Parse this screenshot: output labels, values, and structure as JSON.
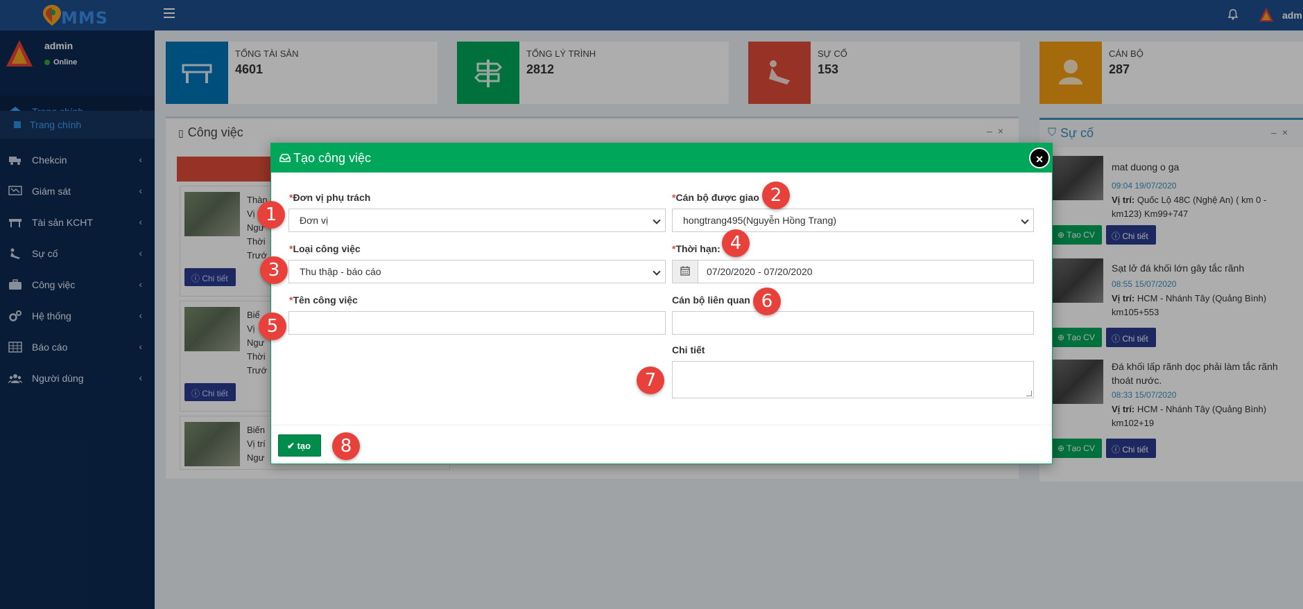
{
  "topbar": {
    "brand": "MMS",
    "user": "adm"
  },
  "sidebar": {
    "user": {
      "name": "admin",
      "status": "Online"
    },
    "items": [
      {
        "label": "Trang chính",
        "icon": "home-icon"
      },
      {
        "label": "Chekcin",
        "icon": "truck-icon"
      },
      {
        "label": "Giám sát",
        "icon": "monitor-icon"
      },
      {
        "label": "Tài sản KCHT",
        "icon": "barrier-icon"
      },
      {
        "label": "Sự cố",
        "icon": "digging-icon"
      },
      {
        "label": "Công việc",
        "icon": "briefcase-icon"
      },
      {
        "label": "Hệ thống",
        "icon": "gears-icon"
      },
      {
        "label": "Báo cáo",
        "icon": "table-icon"
      },
      {
        "label": "Người dùng",
        "icon": "users-icon"
      }
    ],
    "sub_item": "Trang chính"
  },
  "stats": [
    {
      "label": "TỔNG TÀI SẢN",
      "value": "4601",
      "color": "#0073b7"
    },
    {
      "label": "TỔNG LÝ TRÌNH",
      "value": "2812",
      "color": "#00a65a"
    },
    {
      "label": "SỰ CỐ",
      "value": "153",
      "color": "#dd4b39"
    },
    {
      "label": "CÁN BỘ",
      "value": "287",
      "color": "#f39c12"
    }
  ],
  "work_panel": {
    "title": "Công việc",
    "cards": [
      {
        "lines": [
          "Thàn",
          "Vị",
          "Ngư",
          "Thời",
          "Trướ"
        ],
        "button": "Chi tiết"
      },
      {
        "lines": [
          "Biể",
          "Vị",
          "Ngư",
          "Thời",
          "Trướ"
        ],
        "button": "Chi tiết"
      },
      {
        "lines": [
          "Biến",
          "Vị trí",
          "Ngư"
        ],
        "button": ""
      }
    ]
  },
  "incident_panel": {
    "title": "Sự cố",
    "items": [
      {
        "title": "mat duong o ga",
        "time": "09:04 19/07/2020",
        "loc_label": "Vị trí:",
        "loc": "Quốc Lộ 48C (Nghệ An) ( km 0 - km123) Km99+747"
      },
      {
        "title": "Sạt lở đá khối lớn gây tắc rãnh",
        "time": "08:55 15/07/2020",
        "loc_label": "Vị trí:",
        "loc": "HCM - Nhánh Tây (Quảng Bình) km105+553"
      },
      {
        "title": "Đá khối lấp rãnh dọc phải làm tắc rãnh thoát nước.",
        "time": "08:33 15/07/2020",
        "loc_label": "Vị trí:",
        "loc": "HCM - Nhánh Tây (Quảng Bình) km102+19"
      }
    ],
    "btn_tao_cv": "Tạo CV",
    "btn_chi_tiet": "Chi tiết"
  },
  "modal": {
    "title": "Tạo công việc",
    "close": "×",
    "fields": {
      "don_vi": {
        "label": "Đơn vị phụ trách",
        "value": "Đơn vị"
      },
      "can_bo": {
        "label": "Cán bộ được giao",
        "value": "hongtrang495(Nguyễn Hồng Trang)"
      },
      "loai": {
        "label": "Loại công việc",
        "value": "Thu thập - báo cáo"
      },
      "thoi_han": {
        "label": "Thời hạn:",
        "value": "07/20/2020 - 07/20/2020"
      },
      "ten": {
        "label": "Tên công việc",
        "value": ""
      },
      "lien_quan": {
        "label": "Cán bộ liên quan",
        "value": ""
      },
      "chi_tiet": {
        "label": "Chi tiết",
        "value": ""
      }
    },
    "required_mark": "*",
    "submit": "tạo"
  },
  "badges": [
    "1",
    "2",
    "3",
    "4",
    "5",
    "6",
    "7",
    "8"
  ]
}
